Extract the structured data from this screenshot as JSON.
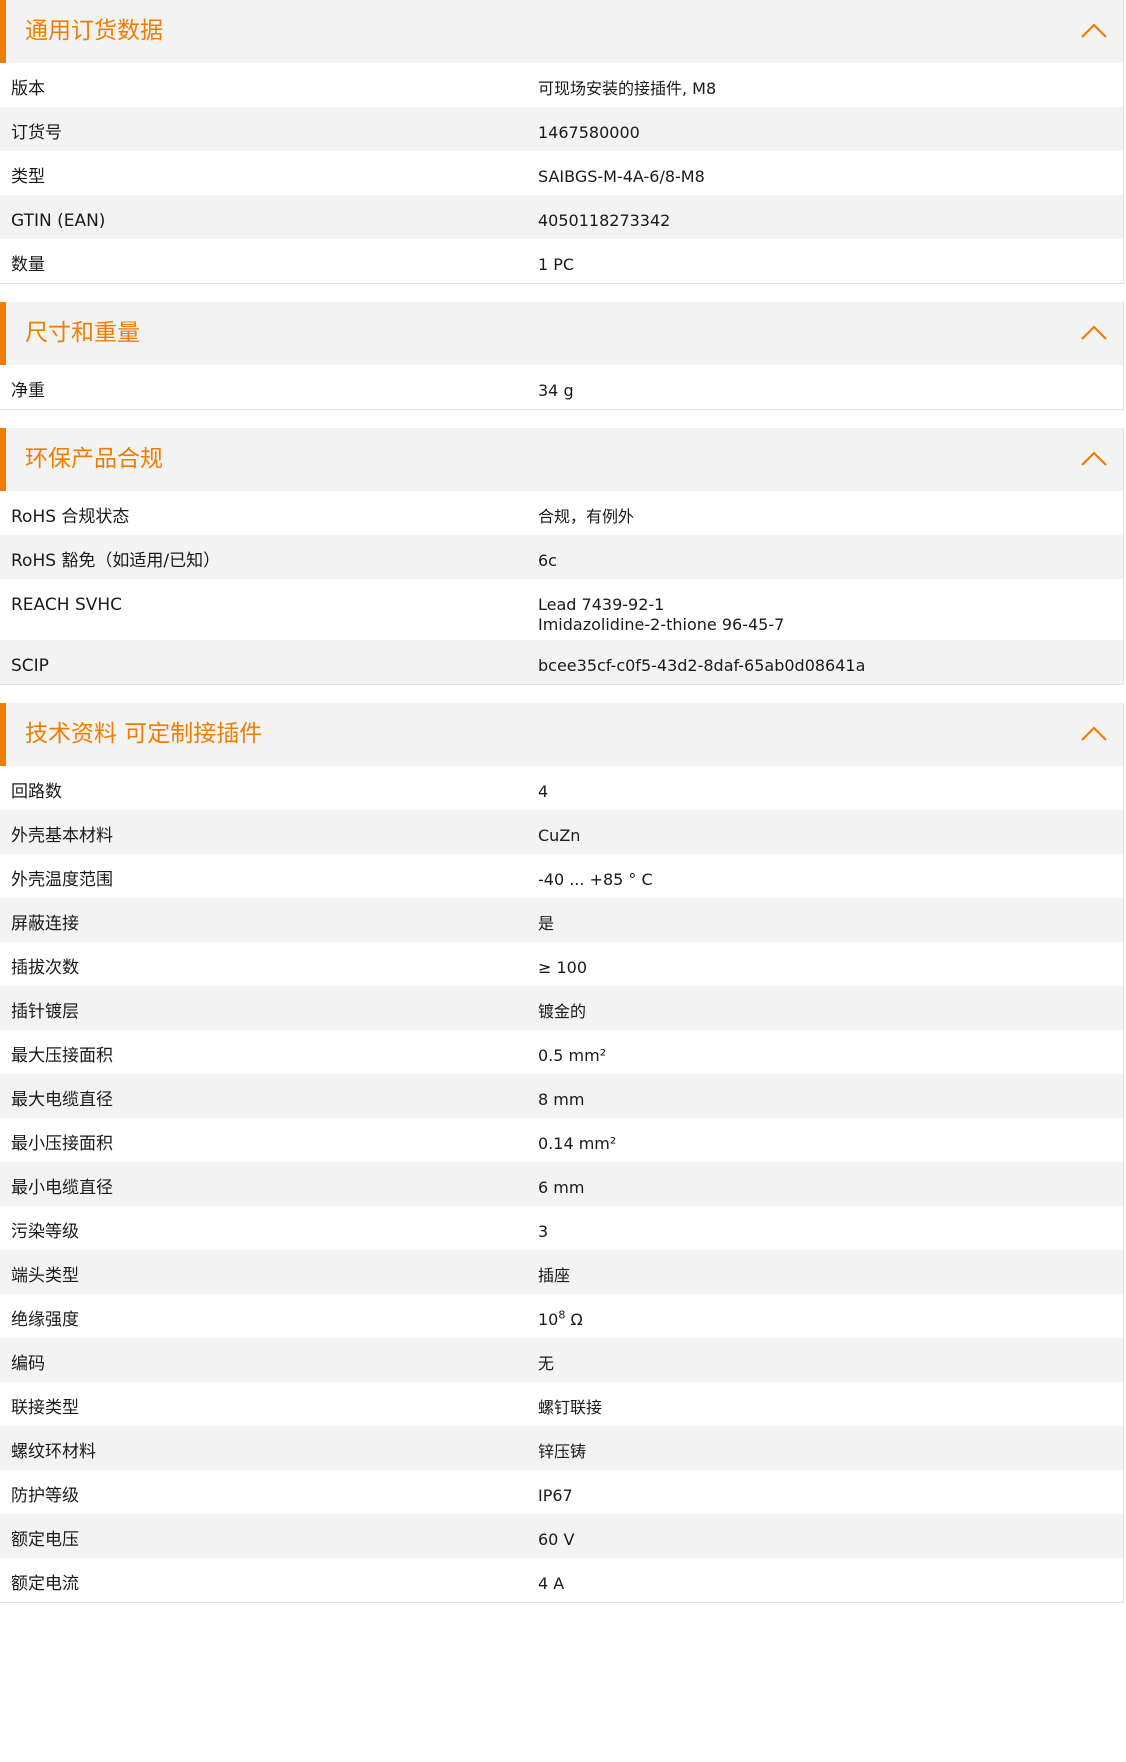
{
  "sections": [
    {
      "title": "通用订货数据",
      "rows": [
        {
          "label": "版本",
          "value": [
            "可现场安装的接插件, M8"
          ]
        },
        {
          "label": "订货号",
          "value": [
            "1467580000"
          ]
        },
        {
          "label": "类型",
          "value": [
            "SAIBGS-M-4A-6/8-M8"
          ]
        },
        {
          "label": "GTIN (EAN)",
          "value": [
            "4050118273342"
          ]
        },
        {
          "label": "数量",
          "value": [
            "1  PC"
          ]
        }
      ]
    },
    {
      "title": "尺寸和重量",
      "rows": [
        {
          "label": "净重",
          "value": [
            "34  g"
          ]
        }
      ]
    },
    {
      "title": "环保产品合规",
      "rows": [
        {
          "label": "RoHS 合规状态",
          "value": [
            "合规，有例外"
          ]
        },
        {
          "label": "RoHS 豁免（如适用/已知）",
          "value": [
            "6c"
          ]
        },
        {
          "label": "REACH SVHC",
          "value": [
            "Lead 7439-92-1",
            "Imidazolidine-2-thione 96-45-7"
          ]
        },
        {
          "label": "SCIP",
          "value": [
            "bcee35cf-c0f5-43d2-8daf-65ab0d08641a"
          ]
        }
      ]
    },
    {
      "title": "技术资料 可定制接插件",
      "rows": [
        {
          "label": "回路数",
          "value": [
            "4"
          ]
        },
        {
          "label": "外壳基本材料",
          "value": [
            "CuZn"
          ]
        },
        {
          "label": "外壳温度范围",
          "value": [
            "-40 ... +85 ° C"
          ]
        },
        {
          "label": "屏蔽连接",
          "value": [
            "是"
          ]
        },
        {
          "label": "插拔次数",
          "value": [
            "≥ 100"
          ]
        },
        {
          "label": "插针镀层",
          "value": [
            "镀金的"
          ]
        },
        {
          "label": "最大压接面积",
          "value": [
            "0.5  mm²"
          ]
        },
        {
          "label": "最大电缆直径",
          "value": [
            "8  mm"
          ]
        },
        {
          "label": "最小压接面积",
          "value": [
            "0.14  mm²"
          ]
        },
        {
          "label": "最小电缆直径",
          "value": [
            "6  mm"
          ]
        },
        {
          "label": "污染等级",
          "value": [
            "3"
          ]
        },
        {
          "label": "端头类型",
          "value": [
            "插座"
          ]
        },
        {
          "label": "绝缘强度",
          "value": [
            "10"
          ],
          "value_sup": "8",
          "value_suffix": " Ω"
        },
        {
          "label": "编码",
          "value": [
            "无"
          ]
        },
        {
          "label": "联接类型",
          "value": [
            "螺钉联接"
          ]
        },
        {
          "label": "螺纹环材料",
          "value": [
            "锌压铸"
          ]
        },
        {
          "label": "防护等级",
          "value": [
            "IP67"
          ]
        },
        {
          "label": "额定电压",
          "value": [
            "60  V"
          ]
        },
        {
          "label": "额定电流",
          "value": [
            "4  A"
          ]
        }
      ]
    }
  ],
  "icons": {
    "collapse": "chevron-up-icon"
  },
  "colors": {
    "accent": "#f07d00",
    "row_alt": "#f3f3f3",
    "text": "#1a1a1a"
  }
}
